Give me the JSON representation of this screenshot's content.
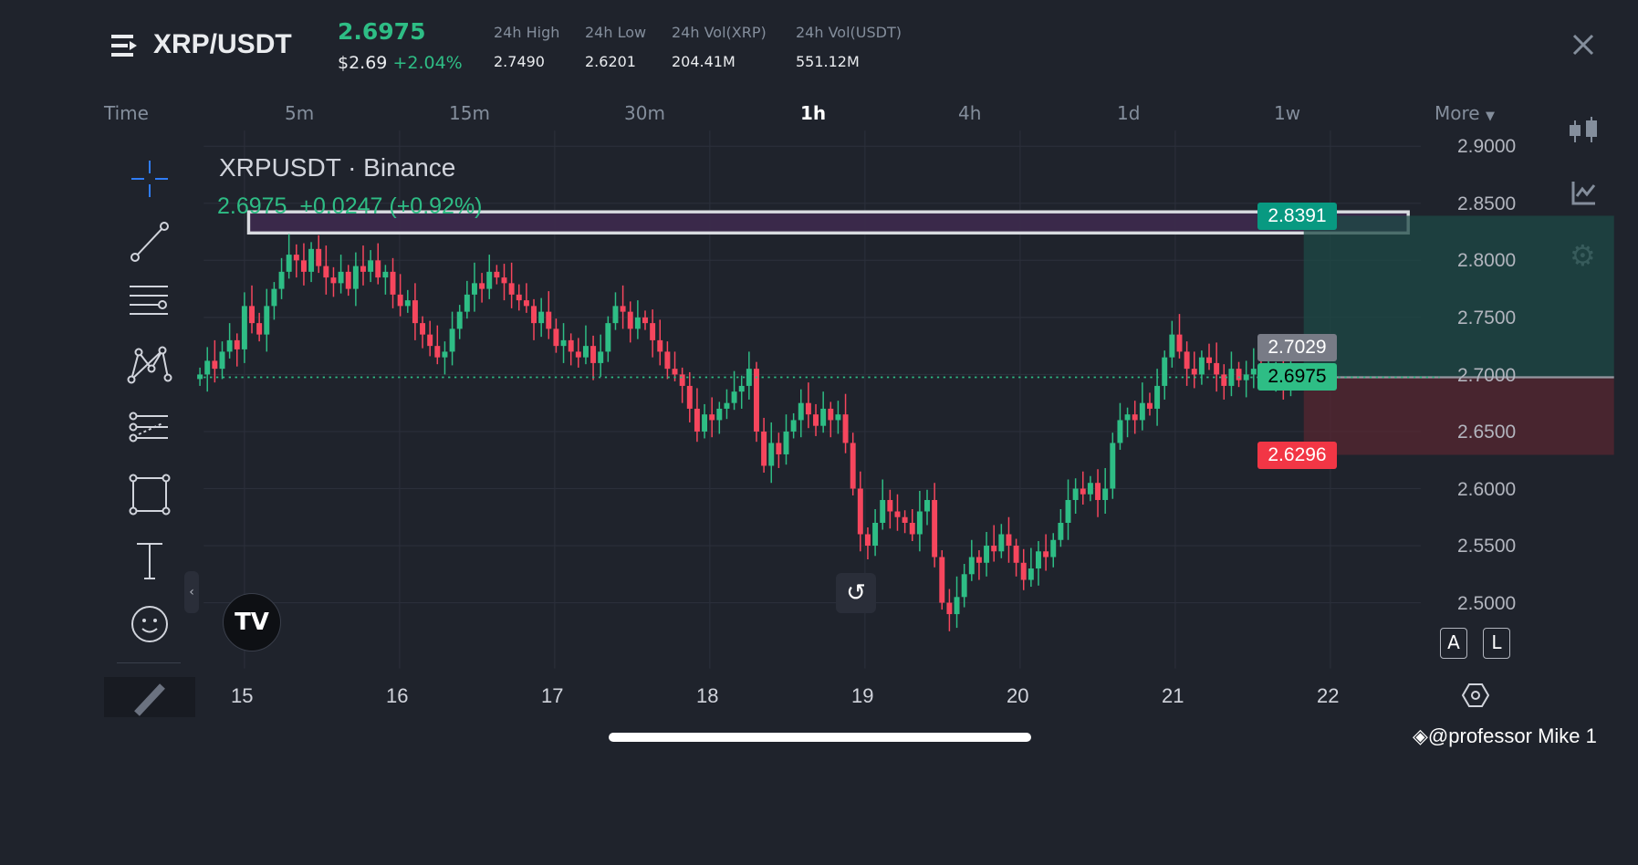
{
  "header": {
    "pair": "XRP/USDT",
    "last_price": "2.6975",
    "usd_price": "$2.69",
    "change_pct": "+2.04%",
    "stats": [
      {
        "label": "24h High",
        "value": "2.7490"
      },
      {
        "label": "24h Low",
        "value": "2.6201"
      },
      {
        "label": "24h Vol(XRP)",
        "value": "204.41M"
      },
      {
        "label": "24h Vol(USDT)",
        "value": "551.12M"
      }
    ],
    "close_icon": "close-icon"
  },
  "timeframes": {
    "label": "Time",
    "items": [
      "5m",
      "15m",
      "30m",
      "1h",
      "4h",
      "1d",
      "1w"
    ],
    "active": "1h",
    "more": "More"
  },
  "legend": {
    "symbol": "XRPUSDT · Binance",
    "ohlc": "2.6975  +0.0247 (+0.92%)"
  },
  "colors": {
    "up": "#2ebd85",
    "down": "#f6465d",
    "bg": "#1f232c"
  },
  "price_badges": {
    "take_profit": "2.8391",
    "entry": "2.7029",
    "last": "2.6975",
    "stop_loss": "2.6296"
  },
  "controls": {
    "auto": "A",
    "log": "L"
  },
  "watermark": "@professor Mike 1",
  "chart_data": {
    "type": "candlestick",
    "title": "XRPUSDT · Binance",
    "interval": "1h",
    "x_tick_labels": [
      "15",
      "16",
      "17",
      "18",
      "19",
      "20",
      "21",
      "22"
    ],
    "y_tick_labels": [
      "2.9000",
      "2.8500",
      "2.8000",
      "2.7500",
      "2.7000",
      "2.6500",
      "2.6000",
      "2.5500",
      "2.5000"
    ],
    "ylim": [
      2.47,
      2.92
    ],
    "first_candle_offset_hours_before_15": 6,
    "closes": [
      2.7,
      2.712,
      2.705,
      2.72,
      2.73,
      2.722,
      2.76,
      2.745,
      2.735,
      2.76,
      2.775,
      2.79,
      2.805,
      2.8,
      2.79,
      2.81,
      2.795,
      2.785,
      2.78,
      2.79,
      2.775,
      2.795,
      2.79,
      2.8,
      2.785,
      2.79,
      2.77,
      2.76,
      2.765,
      2.745,
      2.735,
      2.725,
      2.715,
      2.72,
      2.74,
      2.755,
      2.77,
      2.78,
      2.775,
      2.79,
      2.785,
      2.78,
      2.77,
      2.765,
      2.76,
      2.745,
      2.755,
      2.74,
      2.725,
      2.73,
      2.72,
      2.715,
      2.725,
      2.71,
      2.72,
      2.745,
      2.76,
      2.755,
      2.74,
      2.75,
      2.745,
      2.73,
      2.72,
      2.705,
      2.7,
      2.69,
      2.67,
      2.65,
      2.665,
      2.66,
      2.67,
      2.675,
      2.685,
      2.69,
      2.705,
      2.65,
      2.62,
      2.64,
      2.63,
      2.65,
      2.66,
      2.675,
      2.665,
      2.655,
      2.67,
      2.66,
      2.665,
      2.64,
      2.6,
      2.56,
      2.55,
      2.57,
      2.59,
      2.58,
      2.575,
      2.57,
      2.56,
      2.58,
      2.59,
      2.54,
      2.5,
      2.49,
      2.505,
      2.525,
      2.54,
      2.535,
      2.55,
      2.545,
      2.56,
      2.55,
      2.535,
      2.52,
      2.53,
      2.545,
      2.54,
      2.555,
      2.57,
      2.59,
      2.6,
      2.595,
      2.605,
      2.59,
      2.6,
      2.64,
      2.66,
      2.665,
      2.66,
      2.675,
      2.67,
      2.69,
      2.715,
      2.735,
      2.72,
      2.705,
      2.7,
      2.715,
      2.71,
      2.7,
      2.69,
      2.705,
      2.695,
      2.7,
      2.705,
      2.695,
      2.7,
      2.705,
      2.69,
      2.6975
    ],
    "position_tool": {
      "take_profit": 2.8391,
      "entry": 2.6975,
      "stop_loss": 2.6296
    },
    "highlight_zone": {
      "top": 2.8425,
      "bottom": 2.824
    },
    "last_price_line": 2.6975
  }
}
